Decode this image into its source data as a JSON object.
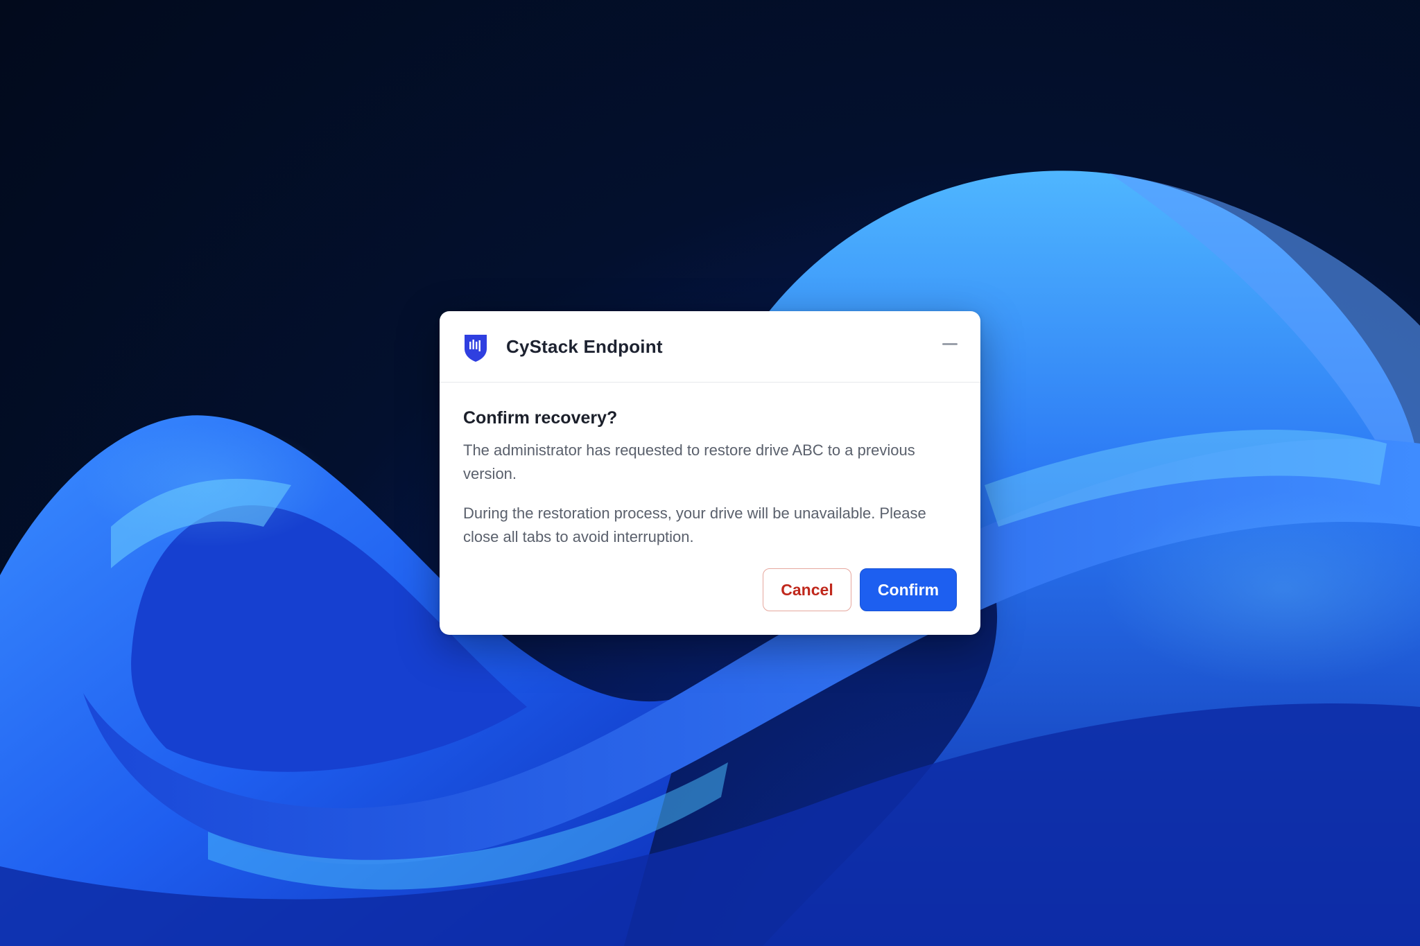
{
  "dialog": {
    "app_name": "CyStack Endpoint",
    "heading": "Confirm recovery?",
    "message_1": "The administrator has requested to restore drive ABC to a previous version.",
    "message_2": "During the restoration process, your drive will be unavailable. Please close all tabs to avoid interruption.",
    "cancel_label": "Cancel",
    "confirm_label": "Confirm",
    "icons": {
      "logo": "shield-logo-icon",
      "minimize": "minimize-icon"
    }
  },
  "colors": {
    "accent": "#1d5ff0",
    "cancel_text": "#c0281c",
    "logo": "#2f3fe0"
  }
}
